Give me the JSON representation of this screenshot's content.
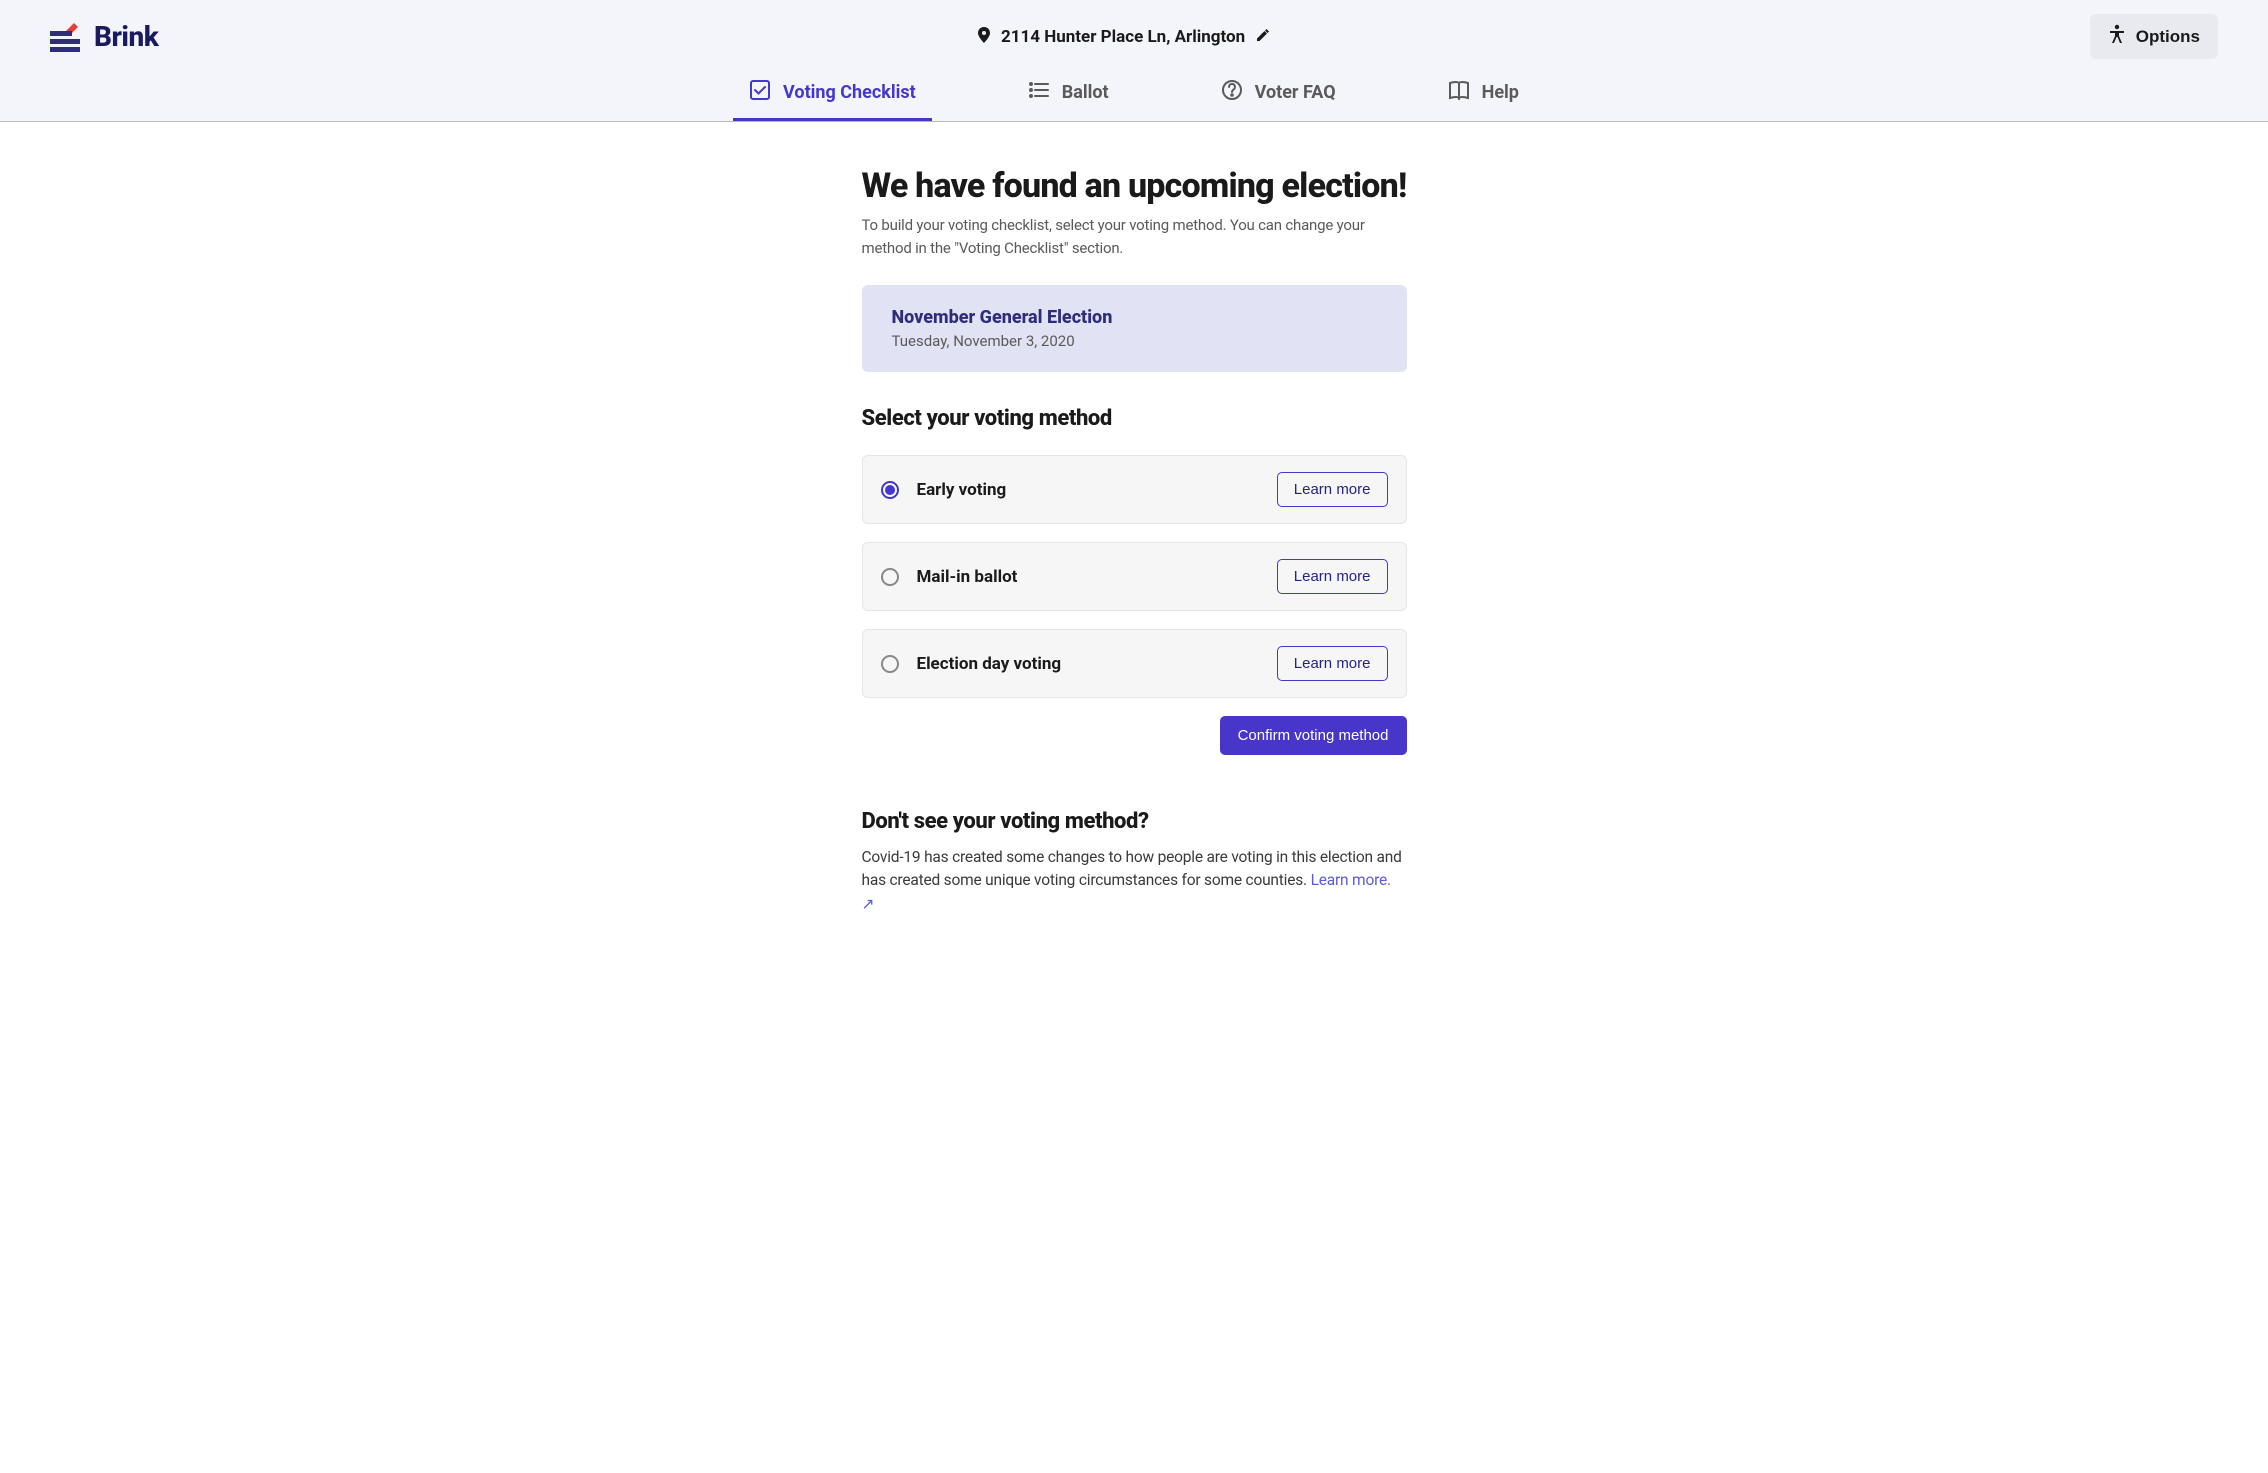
{
  "header": {
    "logo_text": "Brink",
    "address": "2114 Hunter Place Ln, Arlington",
    "options_label": "Options"
  },
  "nav": {
    "tabs": [
      {
        "label": "Voting Checklist",
        "active": true
      },
      {
        "label": "Ballot",
        "active": false
      },
      {
        "label": "Voter FAQ",
        "active": false
      },
      {
        "label": "Help",
        "active": false
      }
    ]
  },
  "main": {
    "title": "We have found an upcoming election!",
    "subtitle": "To build your voting checklist, select your voting method. You can change your method in the \"Voting Checklist\" section.",
    "election": {
      "name": "November General Election",
      "date": "Tuesday, November 3, 2020"
    },
    "section_title": "Select your voting method",
    "methods": [
      {
        "label": "Early voting",
        "learn_more": "Learn more",
        "selected": true
      },
      {
        "label": "Mail-in ballot",
        "learn_more": "Learn more",
        "selected": false
      },
      {
        "label": "Election day voting",
        "learn_more": "Learn more",
        "selected": false
      }
    ],
    "confirm_label": "Confirm voting method"
  },
  "footer": {
    "title": "Don't see your voting method?",
    "text": "Covid-19 has created some changes to how people are voting in this election and has created some unique voting circumstances for some counties. ",
    "link_label": "Learn more."
  }
}
